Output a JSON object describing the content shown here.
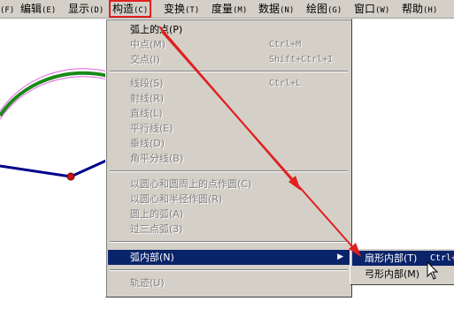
{
  "menubar": {
    "items": [
      {
        "label": "(F)"
      },
      {
        "label": "编辑",
        "accel": "(E)"
      },
      {
        "label": "显示",
        "accel": "(D)"
      },
      {
        "label": "构造",
        "accel": "(C)"
      },
      {
        "label": "变换",
        "accel": "(T)"
      },
      {
        "label": "度量",
        "accel": "(M)"
      },
      {
        "label": "数据",
        "accel": "(N)"
      },
      {
        "label": "绘图",
        "accel": "(G)"
      },
      {
        "label": "窗口",
        "accel": "(W)"
      },
      {
        "label": "帮助",
        "accel": "(H)"
      }
    ]
  },
  "construct_menu": {
    "items": [
      {
        "label": "弧上的点(P)",
        "shortcut": ""
      },
      {
        "label": "中点(M)",
        "shortcut": "Ctrl+M"
      },
      {
        "label": "交点(I)",
        "shortcut": "Shift+Ctrl+I"
      },
      {
        "label": "线段(S)",
        "shortcut": "Ctrl+L"
      },
      {
        "label": "射线(R)",
        "shortcut": ""
      },
      {
        "label": "直线(L)",
        "shortcut": ""
      },
      {
        "label": "平行线(E)",
        "shortcut": ""
      },
      {
        "label": "垂线(D)",
        "shortcut": ""
      },
      {
        "label": "角平分线(B)",
        "shortcut": ""
      },
      {
        "label": "以圆心和圆周上的点作圆(C)",
        "shortcut": ""
      },
      {
        "label": "以圆心和半径作圆(R)",
        "shortcut": ""
      },
      {
        "label": "圆上的弧(A)",
        "shortcut": ""
      },
      {
        "label": "过三点弧(3)",
        "shortcut": ""
      },
      {
        "label": "弧内部(N)",
        "shortcut": ""
      },
      {
        "label": "轨迹(U)",
        "shortcut": ""
      }
    ]
  },
  "submenu": {
    "items": [
      {
        "label": "扇形内部(T)",
        "shortcut": "Ctrl+"
      },
      {
        "label": "弓形内部(M)",
        "shortcut": ""
      }
    ]
  },
  "colors": {
    "menu_bg": "#d4d0c8",
    "highlight": "#0a246a",
    "annotation_red": "#e02020",
    "arc_green": "#1a8a1a",
    "arc_magenta": "#e060e0",
    "segment_navy": "#00008b",
    "point_red": "#d01010"
  }
}
